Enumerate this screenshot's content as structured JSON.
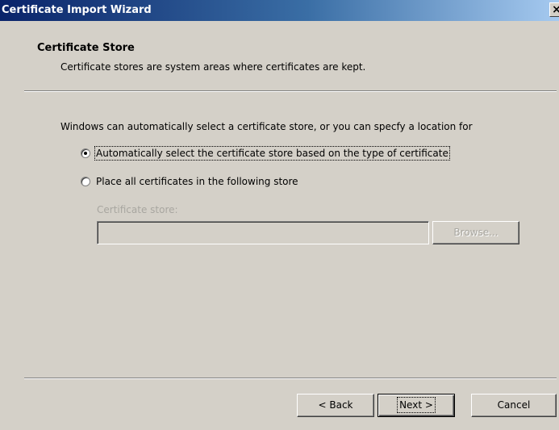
{
  "window": {
    "title": "Certificate Import Wizard",
    "close_glyph": "×"
  },
  "header": {
    "title": "Certificate Store",
    "subtitle": "Certificate stores are system areas where certificates are kept."
  },
  "body": {
    "intro": "Windows can automatically select a certificate store, or you can specfy a location for",
    "options": [
      {
        "label": "Automatically select the certificate store based on the type of certificate",
        "checked": true
      },
      {
        "label": "Place all certificates in the following store",
        "checked": false
      }
    ],
    "store_label": "Certificate store:",
    "store_value": "",
    "browse_label": "Browse..."
  },
  "footer": {
    "back_label": "< Back",
    "next_label": "Next >",
    "cancel_label": "Cancel"
  }
}
